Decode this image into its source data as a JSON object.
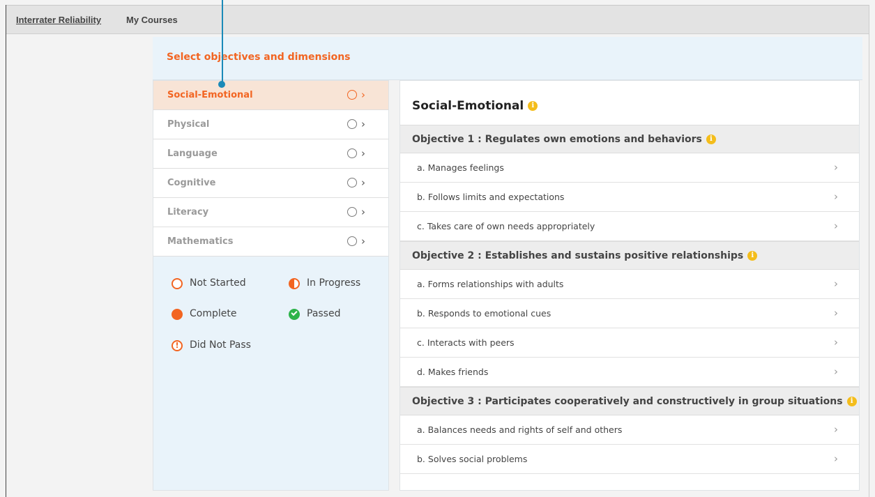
{
  "topnav": {
    "links": [
      "Interrater Reliability",
      "My Courses"
    ]
  },
  "header": {
    "title": "Select objectives and dimensions"
  },
  "domains": [
    {
      "label": "Social-Emotional",
      "active": true
    },
    {
      "label": "Physical",
      "active": false
    },
    {
      "label": "Language",
      "active": false
    },
    {
      "label": "Cognitive",
      "active": false
    },
    {
      "label": "Literacy",
      "active": false
    },
    {
      "label": "Mathematics",
      "active": false
    }
  ],
  "legend": {
    "not_started": "Not Started",
    "in_progress": "In Progress",
    "complete": "Complete",
    "passed": "Passed",
    "did_not_pass": "Did Not Pass"
  },
  "detail": {
    "title": "Social-Emotional",
    "objectives": [
      {
        "title": "Objective 1 : Regulates own emotions and behaviors",
        "dimensions": [
          "a. Manages feelings",
          "b. Follows limits and expectations",
          "c. Takes care of own needs appropriately"
        ]
      },
      {
        "title": "Objective 2 : Establishes and sustains positive relationships",
        "dimensions": [
          "a. Forms relationships with adults",
          "b. Responds to emotional cues",
          "c. Interacts with peers",
          "d. Makes friends"
        ]
      },
      {
        "title": "Objective 3 : Participates cooperatively and constructively in group situations",
        "dimensions": [
          "a. Balances needs and rights of self and others",
          "b. Solves social problems"
        ]
      }
    ]
  },
  "colors": {
    "accent": "#f26522",
    "callout": "#1b8ab8",
    "info": "#f4bd1b",
    "passed": "#2db34a"
  },
  "icons": {
    "status": "circle-outline-icon",
    "chevron": "chevron-right-icon",
    "info": "info-icon"
  }
}
